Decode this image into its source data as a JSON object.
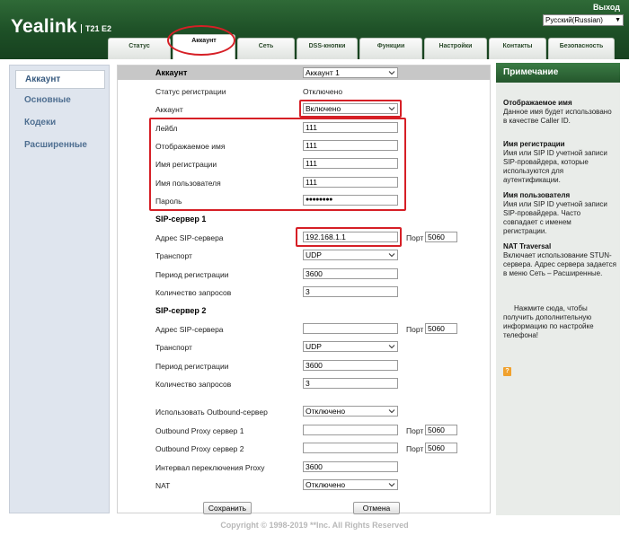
{
  "header": {
    "logo": "Yealink",
    "model": "T21 E2",
    "logout": "Выход",
    "language": "Русский(Russian)"
  },
  "tabs": [
    {
      "label": "Статус"
    },
    {
      "label": "Аккаунт"
    },
    {
      "label": "Сеть"
    },
    {
      "label": "DSS-кнопки"
    },
    {
      "label": "Функции"
    },
    {
      "label": "Настройки"
    },
    {
      "label": "Контакты"
    },
    {
      "label": "Безопасность"
    }
  ],
  "sidebar": {
    "items": [
      {
        "label": "Аккаунт"
      },
      {
        "label": "Основные"
      },
      {
        "label": "Кодеки"
      },
      {
        "label": "Расширенные"
      }
    ]
  },
  "account_section": {
    "title": "Аккаунт",
    "account_select": "Аккаунт 1",
    "reg_status_label": "Статус регистрации",
    "reg_status_value": "Отключено",
    "active_label": "Аккаунт",
    "active_value": "Включено",
    "label_label": "Лейбл",
    "label_value": "111",
    "display_name_label": "Отображаемое имя",
    "display_name_value": "111",
    "register_name_label": "Имя регистрации",
    "register_name_value": "111",
    "user_name_label": "Имя пользователя",
    "user_name_value": "111",
    "password_label": "Пароль",
    "password_value": "●●●●●●●●"
  },
  "sip1": {
    "title": "SIP-сервер 1",
    "server_label": "Адрес SIP-сервера",
    "server_value": "192.168.1.1",
    "port_label": "Порт",
    "port_value": "5060",
    "transport_label": "Транспорт",
    "transport_value": "UDP",
    "period_label": "Период регистрации",
    "period_value": "3600",
    "retries_label": "Количество запросов",
    "retries_value": "3"
  },
  "sip2": {
    "title": "SIP-сервер 2",
    "server_label": "Адрес SIP-сервера",
    "server_value": "",
    "port_label": "Порт",
    "port_value": "5060",
    "transport_label": "Транспорт",
    "transport_value": "UDP",
    "period_label": "Период регистрации",
    "period_value": "3600",
    "retries_label": "Количество запросов",
    "retries_value": "3"
  },
  "outbound": {
    "use_label": "Использовать Outbound-сервер",
    "use_value": "Отключено",
    "proxy1_label": "Outbound Proxy сервер 1",
    "proxy1_value": "",
    "proxy1_port_label": "Порт",
    "proxy1_port": "5060",
    "proxy2_label": "Outbound Proxy сервер 2",
    "proxy2_value": "",
    "proxy2_port_label": "Порт",
    "proxy2_port": "5060",
    "fallback_label": "Интервал переключения Proxy",
    "fallback_value": "3600",
    "nat_label": "NAT",
    "nat_value": "Отключено"
  },
  "buttons": {
    "save": "Сохранить",
    "cancel": "Отмена"
  },
  "notes": {
    "title": "Примечание",
    "items": [
      {
        "title": "Отображаемое имя",
        "text": "Данное имя будет использовано в качестве Caller ID."
      },
      {
        "title": "Имя регистрации",
        "text": "Имя или SIP ID учетной записи SIP-провайдера, которые используются для аутентификации."
      },
      {
        "title": "Имя пользователя",
        "text": "Имя или SIP ID учетной записи SIP-провайдера. Часто совпадает с именем регистрации."
      },
      {
        "title": "NAT Traversal",
        "text": "Включает использование STUN-сервера. Адрес сервера задается в меню Сеть – Расширенные."
      }
    ],
    "help_text": "Нажмите сюда, чтобы получить дополнительную информацию по настройке телефона!"
  },
  "footer": "Copyright © 1998-2019 **Inc. All Rights Reserved",
  "colors": {
    "header_green": "#1d4f26",
    "highlight_red": "#d61f26",
    "sidebar_bg": "#dfe5ee",
    "section_gray": "#c7c7c7"
  }
}
